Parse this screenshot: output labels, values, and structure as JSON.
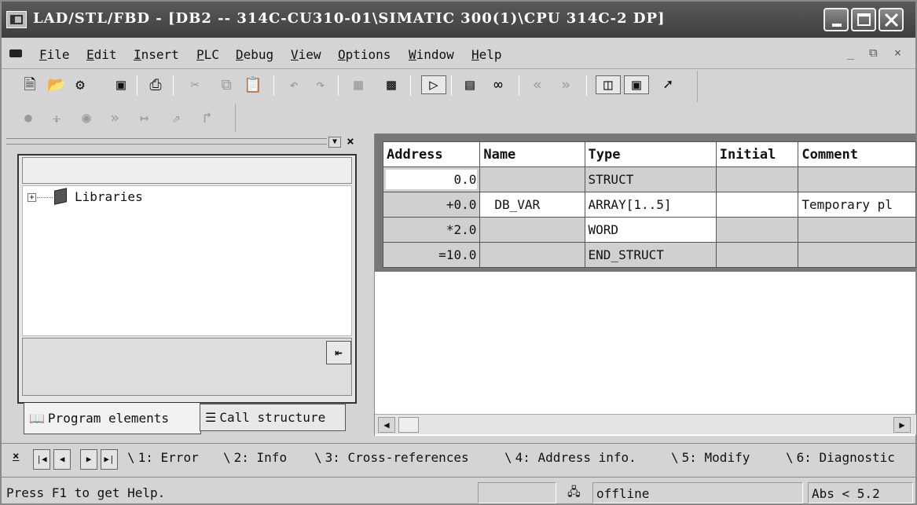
{
  "window": {
    "title": "LAD/STL/FBD  - [DB2 -- 314C-CU310-01\\SIMATIC 300(1)\\CPU 314C-2 DP]"
  },
  "menu": [
    "File",
    "Edit",
    "Insert",
    "PLC",
    "Debug",
    "View",
    "Options",
    "Window",
    "Help"
  ],
  "mdi_controls": [
    "_",
    "⧉",
    "×"
  ],
  "toolbar1": [
    "new-icon",
    "open-icon",
    "accessible-nodes-icon",
    "save-icon",
    "print-icon",
    "cut-icon",
    "copy-icon",
    "paste-icon",
    "undo-icon",
    "redo-icon",
    "compile-icon",
    "download-icon",
    "declaration-view-icon",
    "monitor-network-icon",
    "monitor-icon",
    "prev-error-icon",
    "next-error-icon",
    "overview-icon",
    "details-icon",
    "help-pointer-icon"
  ],
  "toolbar2": [
    "contact-icon",
    "coil-icon",
    "box-icon",
    "open-branch-icon",
    "close-branch-icon",
    "jump-icon",
    "connection-icon"
  ],
  "left_pane": {
    "tree_item": "Libraries",
    "tab_program": "Program elements",
    "tab_call": "Call structure"
  },
  "table": {
    "headers": [
      "Address",
      "Name",
      "Type",
      "Initial",
      "Comment"
    ],
    "rows": [
      [
        "0.0",
        "",
        "STRUCT",
        "",
        ""
      ],
      [
        "+0.0",
        "DB_VAR",
        "ARRAY[1..5]",
        "",
        "Temporary pl"
      ],
      [
        "*2.0",
        "",
        "WORD",
        "",
        ""
      ],
      [
        "=10.0",
        "",
        "END_STRUCT",
        "",
        ""
      ]
    ]
  },
  "details_tabs": [
    "1: Error",
    "2: Info",
    "3: Cross-references",
    "4: Address info.",
    "5: Modify",
    "6: Diagnostic"
  ],
  "status": {
    "help": "Press F1 to get Help.",
    "connection": "offline",
    "position": "Abs < 5.2"
  }
}
